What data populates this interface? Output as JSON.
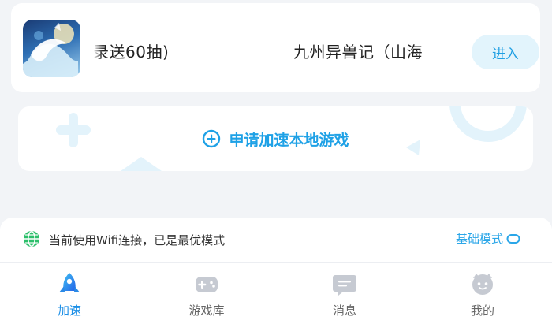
{
  "game_card": {
    "promo_text": "录送60抽)",
    "game_name": "九州异兽记（山海",
    "enter_label": "进入"
  },
  "apply_card": {
    "label": "申请加速本地游戏"
  },
  "status_bar": {
    "text": "当前使用Wifi连接，已是最优模式",
    "mode_label": "基础模式"
  },
  "tabs": [
    {
      "label": "加速",
      "icon": "rocket-icon",
      "active": true
    },
    {
      "label": "游戏库",
      "icon": "gamepad-icon",
      "active": false
    },
    {
      "label": "消息",
      "icon": "message-icon",
      "active": false
    },
    {
      "label": "我的",
      "icon": "profile-icon",
      "active": false
    }
  ],
  "colors": {
    "accent": "#1ea1e6",
    "background": "#f2f4f7",
    "status_green": "#2bbf6a"
  }
}
